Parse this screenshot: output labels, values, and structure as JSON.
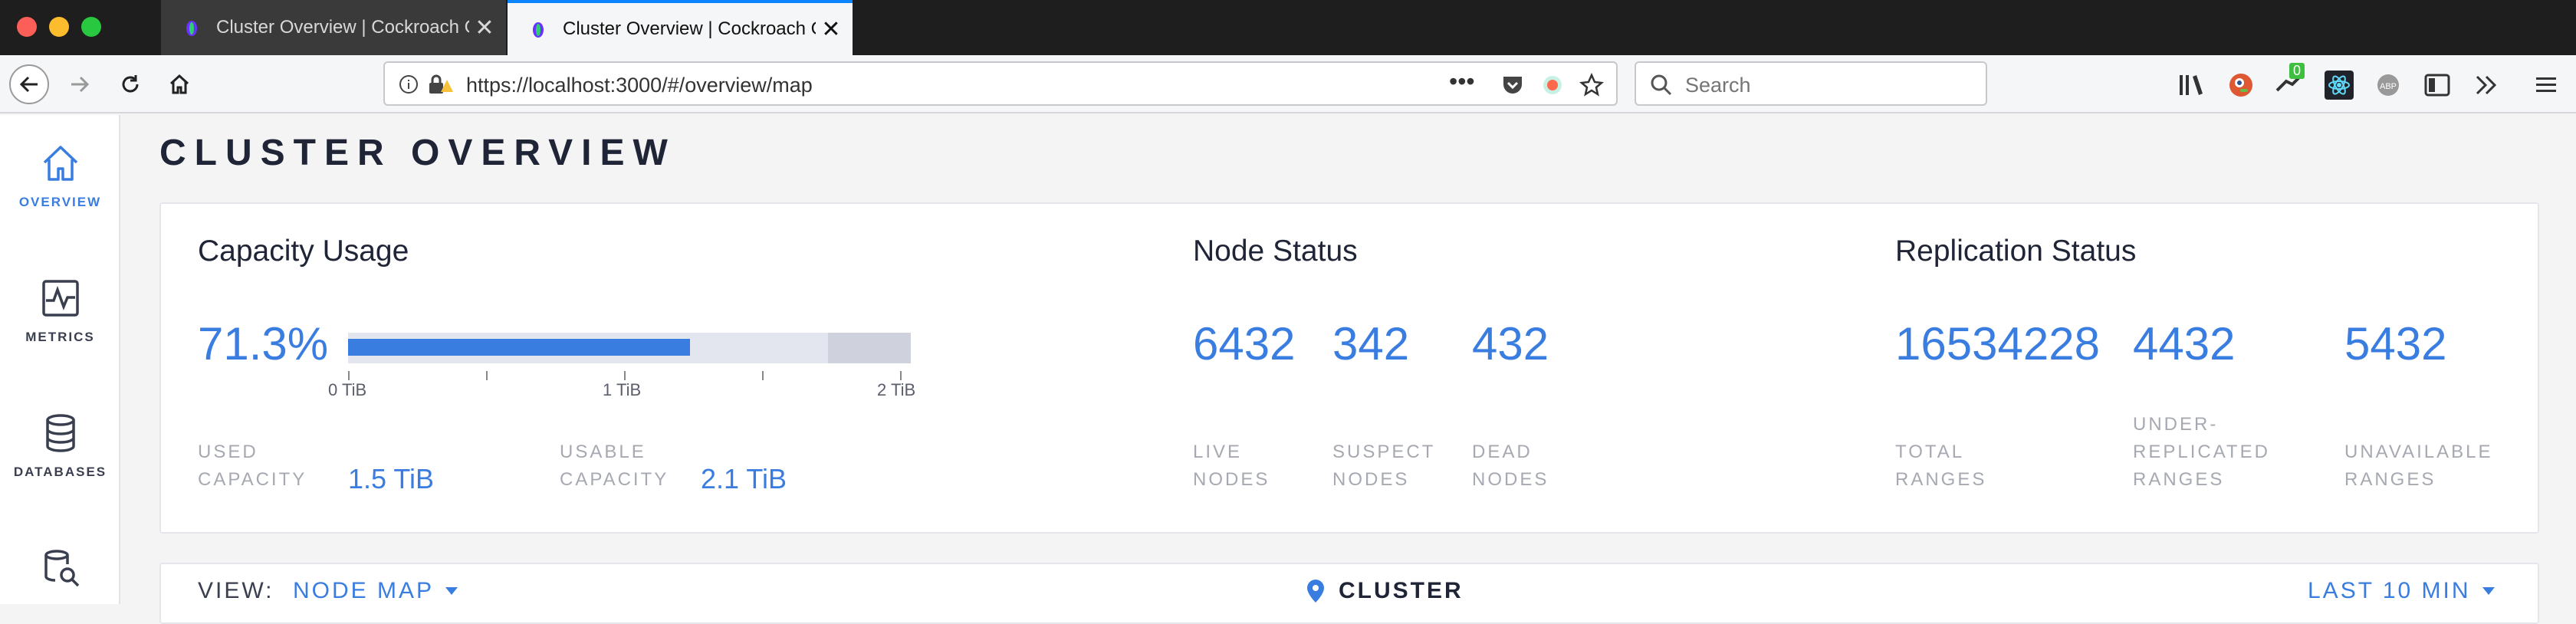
{
  "browser": {
    "tabs": [
      {
        "title": "Cluster Overview | Cockroach Console",
        "active": false
      },
      {
        "title": "Cluster Overview | Cockroach Console",
        "active": true
      }
    ],
    "url": "https://localhost:3000/#/overview/map",
    "search_placeholder": "Search",
    "addon_badge": "0",
    "accent": "#0a84ff"
  },
  "sidebar": {
    "items": [
      {
        "label": "OVERVIEW",
        "icon": "home-icon",
        "active": true
      },
      {
        "label": "METRICS",
        "icon": "metrics-chart-icon",
        "active": false
      },
      {
        "label": "DATABASES",
        "icon": "database-icon",
        "active": false
      },
      {
        "label": "",
        "icon": "database-search-icon",
        "active": false
      }
    ]
  },
  "page": {
    "title": "CLUSTER OVERVIEW"
  },
  "capacity": {
    "title": "Capacity Usage",
    "percent": "71.3%",
    "used_fraction": 0.713,
    "ticks": [
      "0 TiB",
      "1 TiB",
      "2 TiB"
    ],
    "used_label_1": "USED",
    "used_label_2": "CAPACITY",
    "used_value": "1.5 TiB",
    "usable_label_1": "USABLE",
    "usable_label_2": "CAPACITY",
    "usable_value": "2.1 TiB"
  },
  "nodes": {
    "title": "Node Status",
    "live": "6432",
    "suspect": "342",
    "dead": "432",
    "live_label_1": "LIVE",
    "live_label_2": "NODES",
    "suspect_label_1": "SUSPECT",
    "suspect_label_2": "NODES",
    "dead_label_1": "DEAD",
    "dead_label_2": "NODES"
  },
  "replication": {
    "title": "Replication Status",
    "total": "16534228",
    "under": "4432",
    "unavailable": "5432",
    "total_label_1": "TOTAL",
    "total_label_2": "RANGES",
    "under_label_1": "UNDER-",
    "under_label_2": "REPLICATED",
    "under_label_3": "RANGES",
    "unavail_label_1": "UNAVAILABLE",
    "unavail_label_2": "RANGES"
  },
  "viewbar": {
    "view_label": "VIEW:",
    "view_value": "NODE MAP",
    "location": "CLUSTER",
    "time_range": "LAST 10 MIN"
  },
  "colors": {
    "accent_blue": "#3a7de1",
    "bar_used": "#3a7de1",
    "bar_track": "#e3e5ef",
    "bar_reserved": "#cfd1dc",
    "muted_label": "#a6a9b1"
  }
}
